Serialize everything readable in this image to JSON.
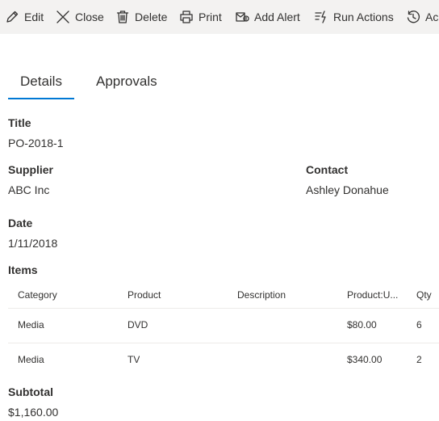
{
  "toolbar": {
    "edit": "Edit",
    "close": "Close",
    "delete": "Delete",
    "print": "Print",
    "add_alert": "Add Alert",
    "run_actions": "Run Actions",
    "activity": "Ac"
  },
  "tabs": {
    "details": "Details",
    "approvals": "Approvals"
  },
  "fields": {
    "title_label": "Title",
    "title_value": "PO-2018-1",
    "supplier_label": "Supplier",
    "supplier_value": "ABC Inc",
    "contact_label": "Contact",
    "contact_value": "Ashley Donahue",
    "date_label": "Date",
    "date_value": "1/11/2018",
    "items_label": "Items",
    "subtotal_label": "Subtotal",
    "subtotal_value": "$1,160.00"
  },
  "items_table": {
    "columns": [
      "Category",
      "Product",
      "Description",
      "Product:U...",
      "Qty"
    ],
    "rows": [
      [
        "Media",
        "DVD",
        "",
        "$80.00",
        "6"
      ],
      [
        "Media",
        "TV",
        "",
        "$340.00",
        "2"
      ]
    ]
  },
  "colors": {
    "toolbar_bg": "#f3f2f1",
    "accent": "#0078d4",
    "text": "#323130"
  }
}
